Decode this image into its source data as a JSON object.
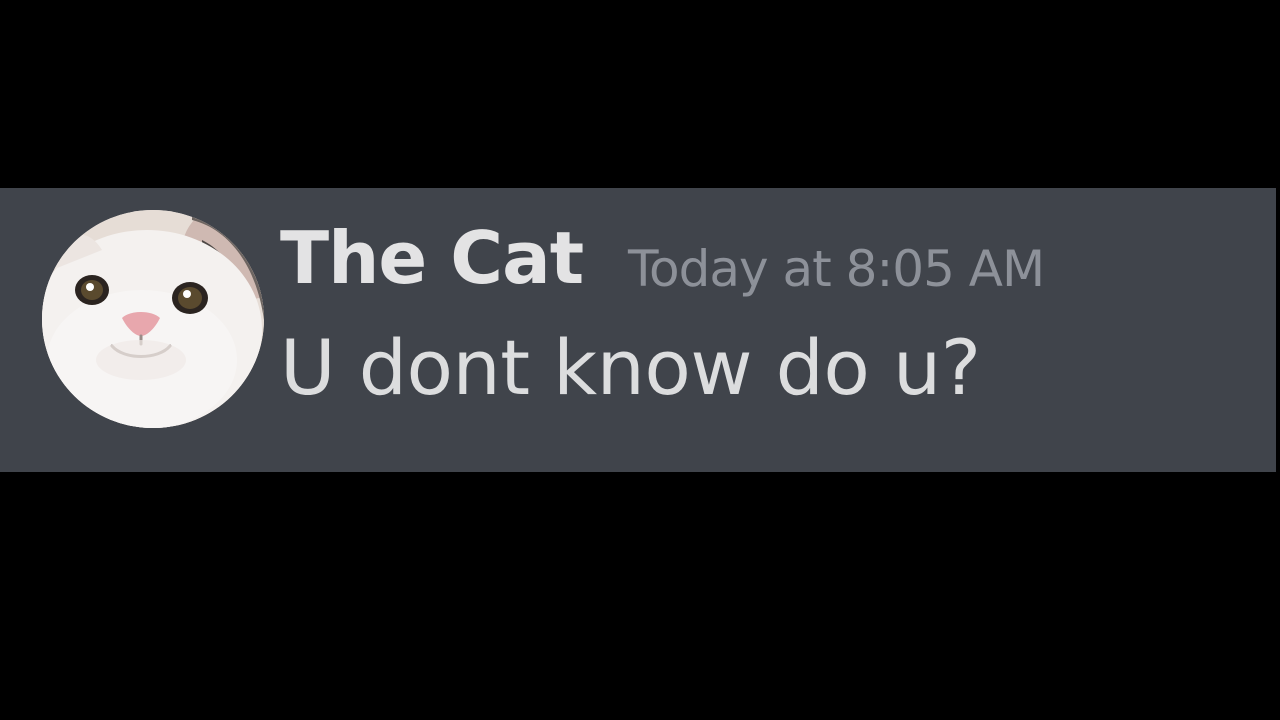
{
  "message": {
    "author": "The Cat",
    "timestamp": "Today at 8:05 AM",
    "content": "U dont know do u?",
    "avatar_icon": "cat-face-avatar"
  },
  "colors": {
    "background": "#000000",
    "message_row": "#40444b",
    "author": "#e3e3e4",
    "timestamp": "#8d9199",
    "content": "#dcddde"
  }
}
